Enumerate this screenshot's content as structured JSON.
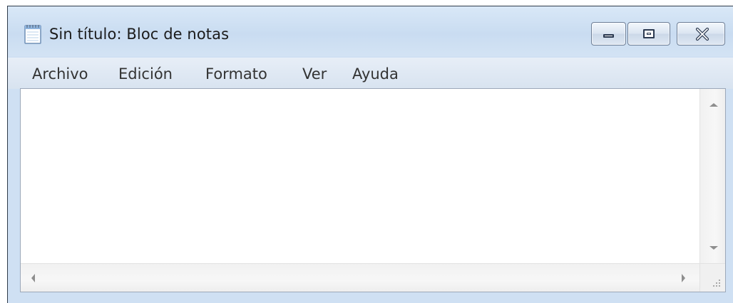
{
  "window": {
    "title": "Sin título: Bloc de notas",
    "app_icon": "notepad-icon",
    "caption_buttons": {
      "minimize_icon": "minimize-icon",
      "maximize_icon": "maximize-icon",
      "close_icon": "close-icon"
    }
  },
  "menubar": {
    "items": [
      {
        "label": "Archivo"
      },
      {
        "label": "Edición"
      },
      {
        "label": "Formato"
      },
      {
        "label": "Ver"
      },
      {
        "label": "Ayuda"
      }
    ]
  },
  "editor": {
    "content": ""
  },
  "scrollbars": {
    "up_icon": "arrow-up-icon",
    "down_icon": "arrow-down-icon",
    "left_icon": "arrow-left-icon",
    "right_icon": "arrow-right-icon",
    "grip_icon": "size-grip-icon"
  },
  "colors": {
    "frame": "#cfe0f3",
    "menu_text": "#333333",
    "title_text": "#1b1b1b"
  }
}
